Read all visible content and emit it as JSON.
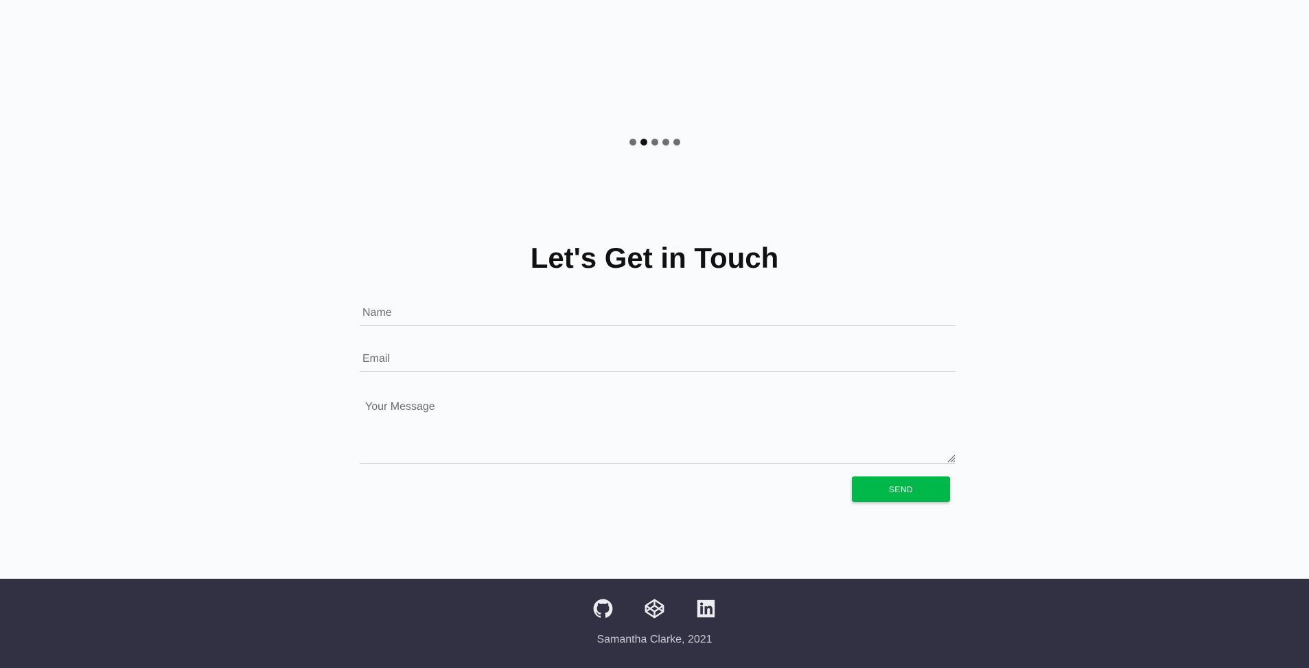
{
  "carousel": {
    "dot_count": 5,
    "active_index": 1
  },
  "contact": {
    "heading": "Let's Get in Touch",
    "name_placeholder": "Name",
    "email_placeholder": "Email",
    "message_placeholder": "Your Message",
    "send_label": "SEND"
  },
  "footer": {
    "icons": [
      "github-icon",
      "codepen-icon",
      "linkedin-icon"
    ],
    "copyright": "Samantha Clarke, 2021"
  },
  "colors": {
    "page_background": "#fafbfc",
    "accent": "#00b84a",
    "footer_background": "#323143",
    "dot_active": "#111111",
    "dot_inactive": "#6f6f6f"
  }
}
